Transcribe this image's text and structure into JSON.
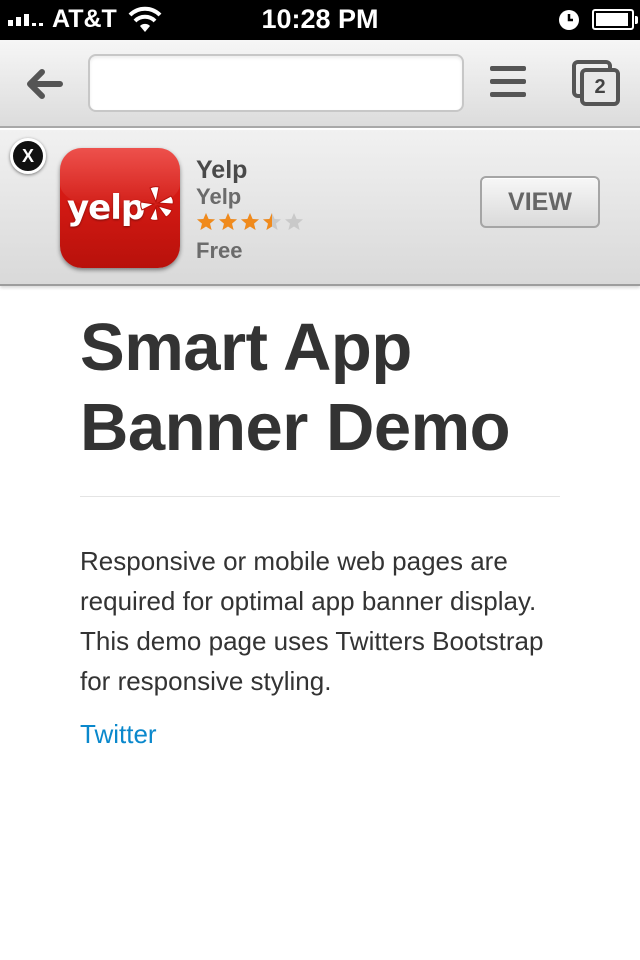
{
  "status_bar": {
    "carrier": "AT&T",
    "time": "10:28 PM"
  },
  "toolbar": {
    "url_value": "",
    "tab_count": "2"
  },
  "app_banner": {
    "close_label": "X",
    "icon_logo_text": "yelp",
    "app_name": "Yelp",
    "developer": "Yelp",
    "rating": 3.5,
    "rating_max": 5,
    "price": "Free",
    "view_label": "VIEW",
    "colors": {
      "icon_red": "#d8190f",
      "star_filled": "#f08a1c",
      "star_empty": "#c9c9c9"
    }
  },
  "page": {
    "title": "Smart App Banner Demo",
    "body_text": "Responsive or mobile web pages are required for optimal app banner display. This demo page uses Twitters Bootstrap for responsive styling.",
    "link_text": "Twitter",
    "link_color": "#0a88cc"
  }
}
